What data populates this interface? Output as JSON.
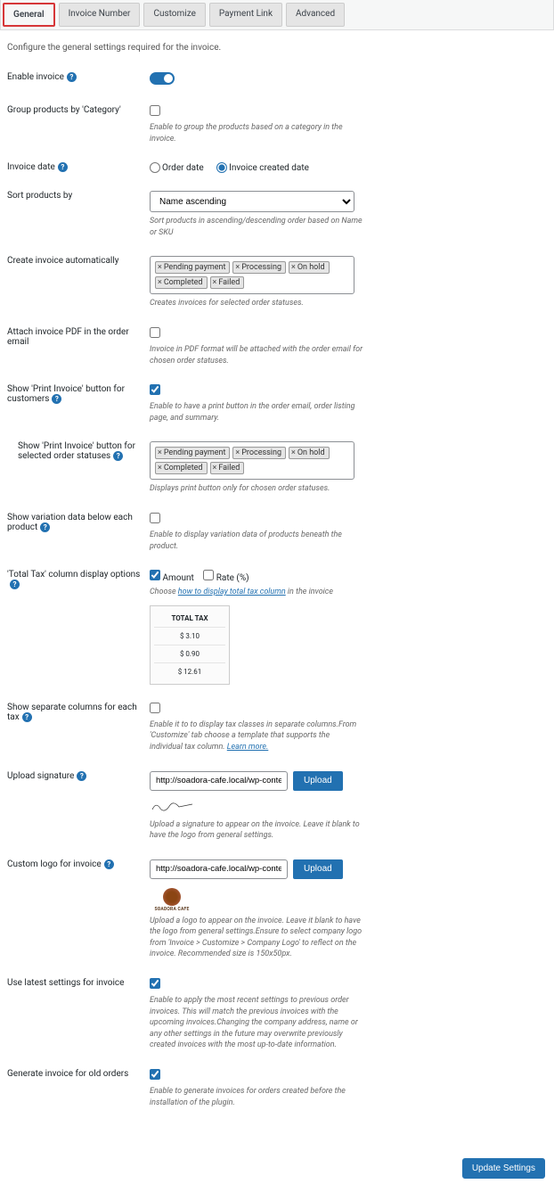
{
  "tabs": {
    "t0": "General",
    "t1": "Invoice Number",
    "t2": "Customize",
    "t3": "Payment Link",
    "t4": "Advanced"
  },
  "intro": "Configure the general settings required for the invoice.",
  "rows": {
    "enable": {
      "label": "Enable invoice"
    },
    "group": {
      "label": "Group products by 'Category'",
      "desc": "Enable to group the products based on a category in the invoice."
    },
    "date": {
      "label": "Invoice date",
      "opt1": "Order date",
      "opt2": "Invoice created date"
    },
    "sort": {
      "label": "Sort products by",
      "value": "Name ascending",
      "desc": "Sort products in ascending/descending order based on Name or SKU"
    },
    "auto": {
      "label": "Create invoice automatically",
      "desc": "Creates invoices for selected order statuses."
    },
    "pdf": {
      "label": "Attach invoice PDF in the order email",
      "desc": "Invoice in PDF format will be attached with the order email for chosen order statuses."
    },
    "print": {
      "label": "Show 'Print Invoice' button for customers",
      "desc": "Enable to have a print button in the order email, order listing page, and summary."
    },
    "printStatus": {
      "label": "Show 'Print Invoice' button for selected order statuses",
      "desc": "Displays print button only for chosen order statuses."
    },
    "variation": {
      "label": "Show variation data below each product",
      "desc": "Enable to display variation data of products beneath the product."
    },
    "totalTax": {
      "label": "'Total Tax' column display options",
      "amount": "Amount",
      "rate": "Rate (%)",
      "descPrefix": "Choose ",
      "descLink": "how to display total tax column",
      "descSuffix": " in the invoice"
    },
    "sepTax": {
      "label": "Show separate columns for each tax",
      "desc": "Enable it to to display tax classes in separate columns.From 'Customize' tab choose a template that supports the individual tax column. ",
      "learn": "Learn more."
    },
    "sig": {
      "label": "Upload signature",
      "url": "http://soadora-cafe.local/wp-content/up",
      "btn": "Upload",
      "desc": "Upload a signature to appear on the invoice. Leave it blank to have the logo from general settings."
    },
    "logo": {
      "label": "Custom logo for invoice",
      "url": "http://soadora-cafe.local/wp-content/up",
      "btn": "Upload",
      "logoText": "SOADORA CAFE",
      "desc": "Upload a logo to appear on the invoice. Leave it blank to have the logo from general settings.Ensure to select company logo from 'Invoice > Customize > Company Logo' to reflect on the invoice. Recommended size is 150x50px."
    },
    "latest": {
      "label": "Use latest settings for invoice",
      "desc": "Enable to apply the most recent settings to previous order invoices. This will match the previous invoices with the upcoming invoices.Changing the company address, name or any other settings in the future may overwrite previously created invoices with the most up-to-date information."
    },
    "old": {
      "label": "Generate invoice for old orders",
      "desc": "Enable to generate invoices for orders created before the installation of the plugin."
    }
  },
  "statuses": {
    "s0": "Pending payment",
    "s1": "Processing",
    "s2": "On hold",
    "s3": "Completed",
    "s4": "Failed"
  },
  "taxTable": {
    "header": "TOTAL TAX",
    "r0": "$ 3.10",
    "r1": "$ 0.90",
    "r2": "$ 12.61"
  },
  "footer": {
    "submit": "Update Settings"
  }
}
